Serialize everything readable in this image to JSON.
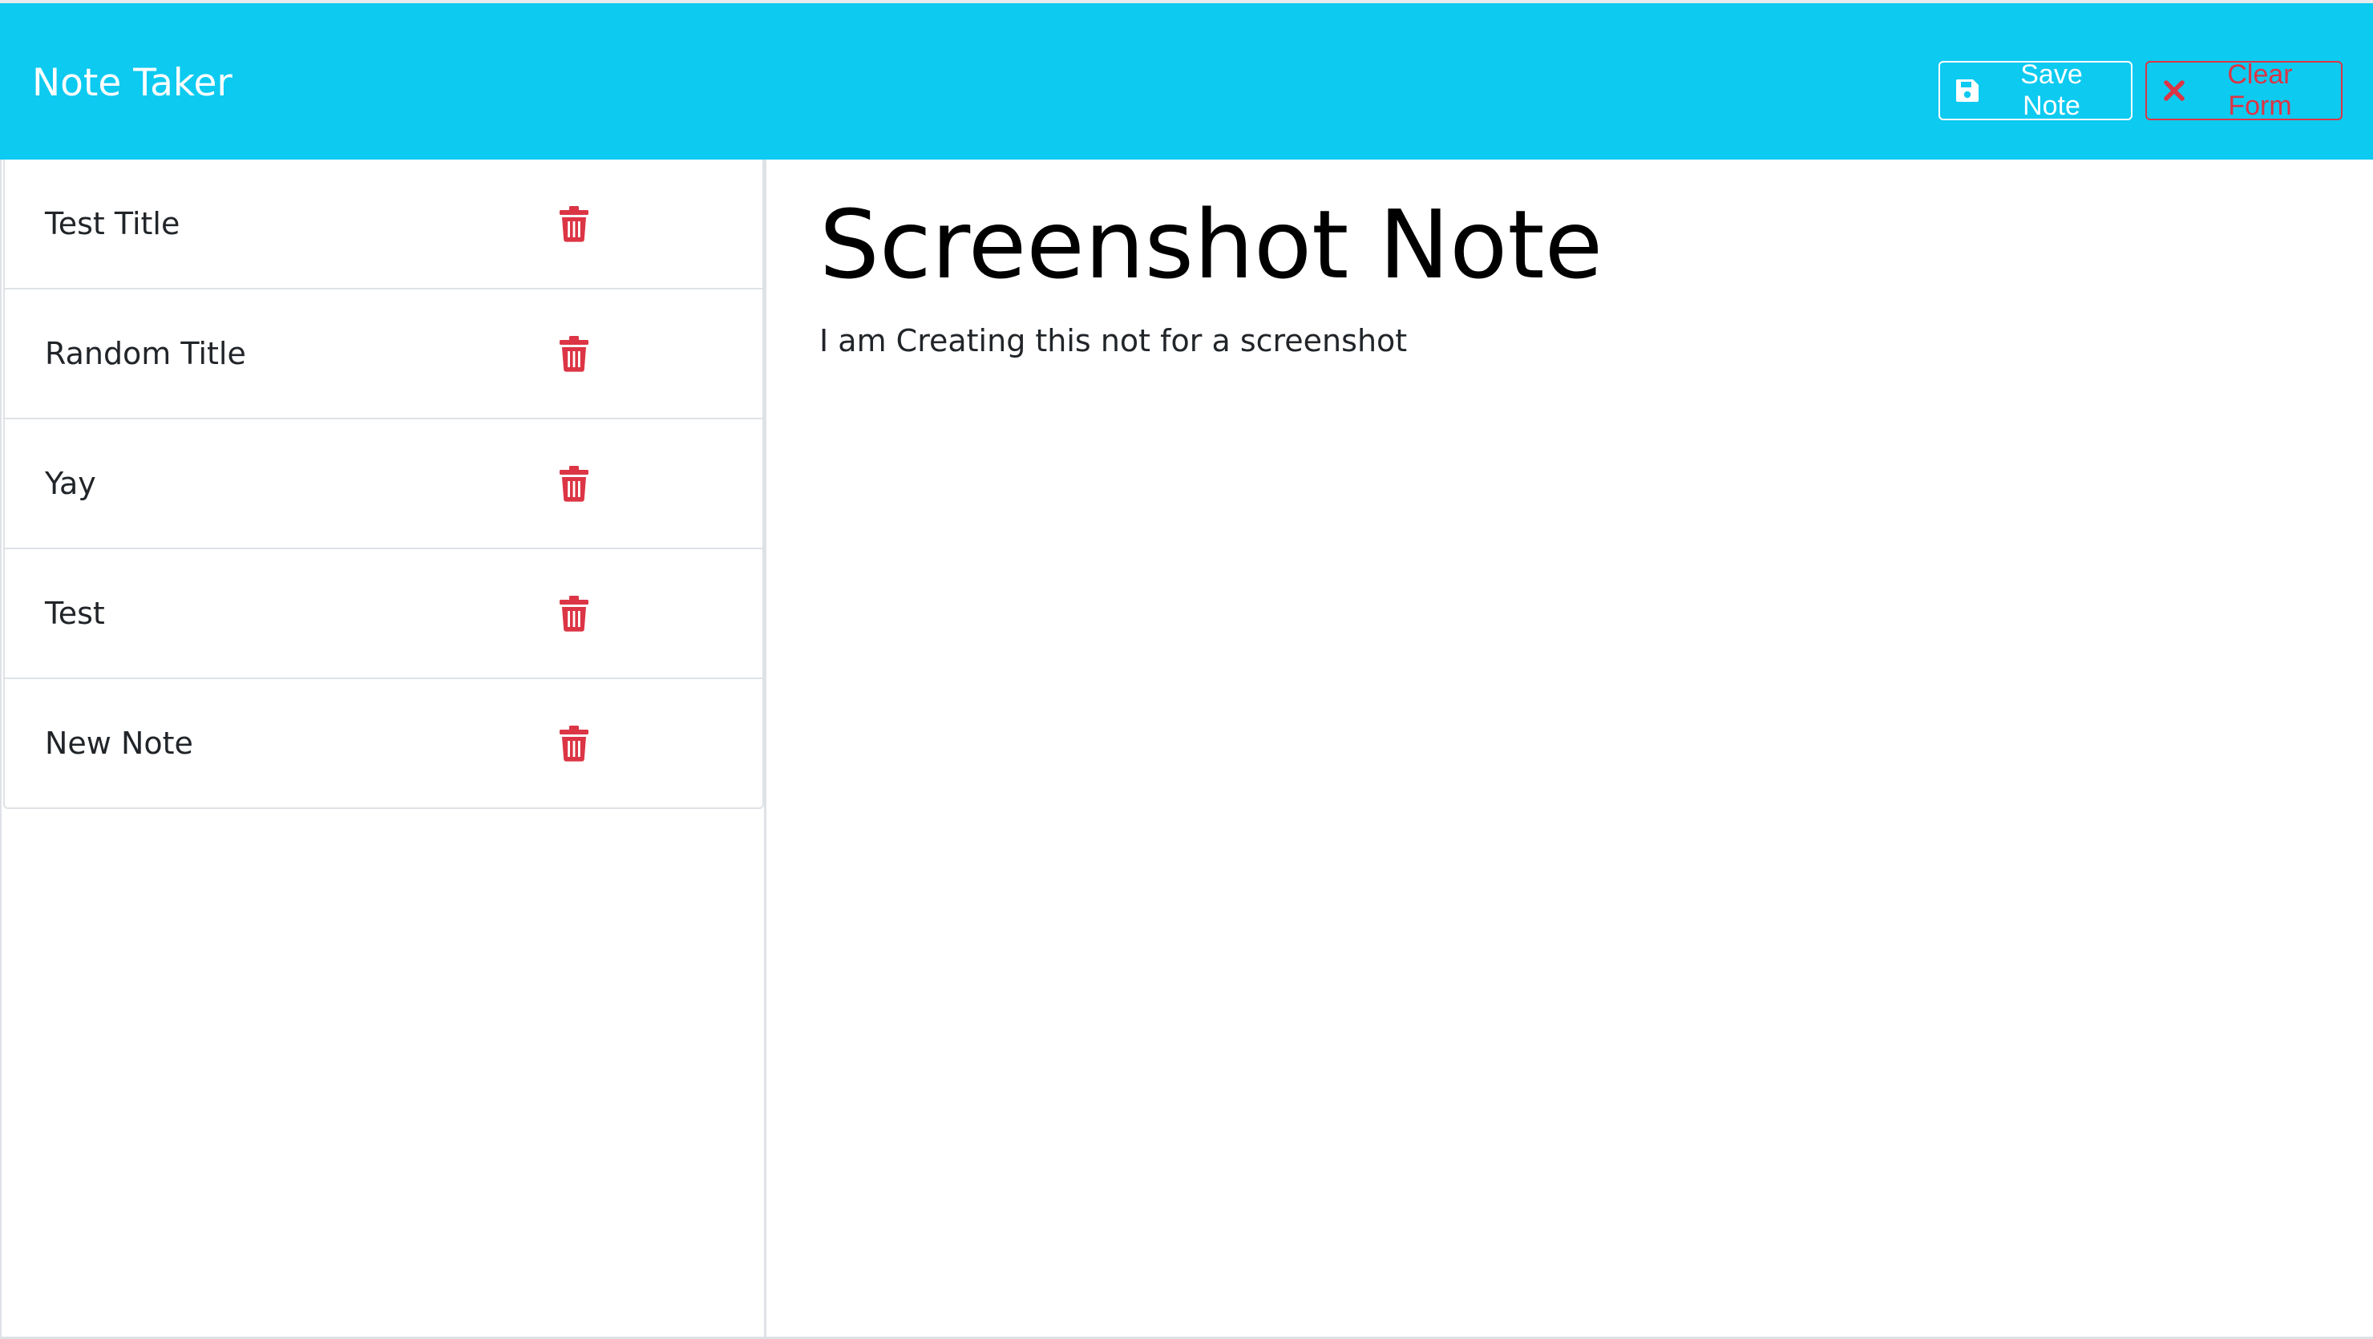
{
  "app": {
    "title": "Note Taker"
  },
  "toolbar": {
    "save_label": "Save Note",
    "clear_label": "Clear Form"
  },
  "notes": [
    {
      "title": "Test Title"
    },
    {
      "title": "Random Title"
    },
    {
      "title": "Yay"
    },
    {
      "title": "Test"
    },
    {
      "title": "New Note"
    }
  ],
  "active_note": {
    "title": "Screenshot Note",
    "text": "I am Creating this not for a screenshot"
  },
  "icons": {
    "save": "floppy-disk-icon",
    "clear": "x-mark-icon",
    "delete": "trash-icon"
  },
  "colors": {
    "navbar": "#0dcaf0",
    "danger": "#dc3545",
    "white": "#ffffff",
    "border": "#dee2e6",
    "text": "#212529"
  }
}
